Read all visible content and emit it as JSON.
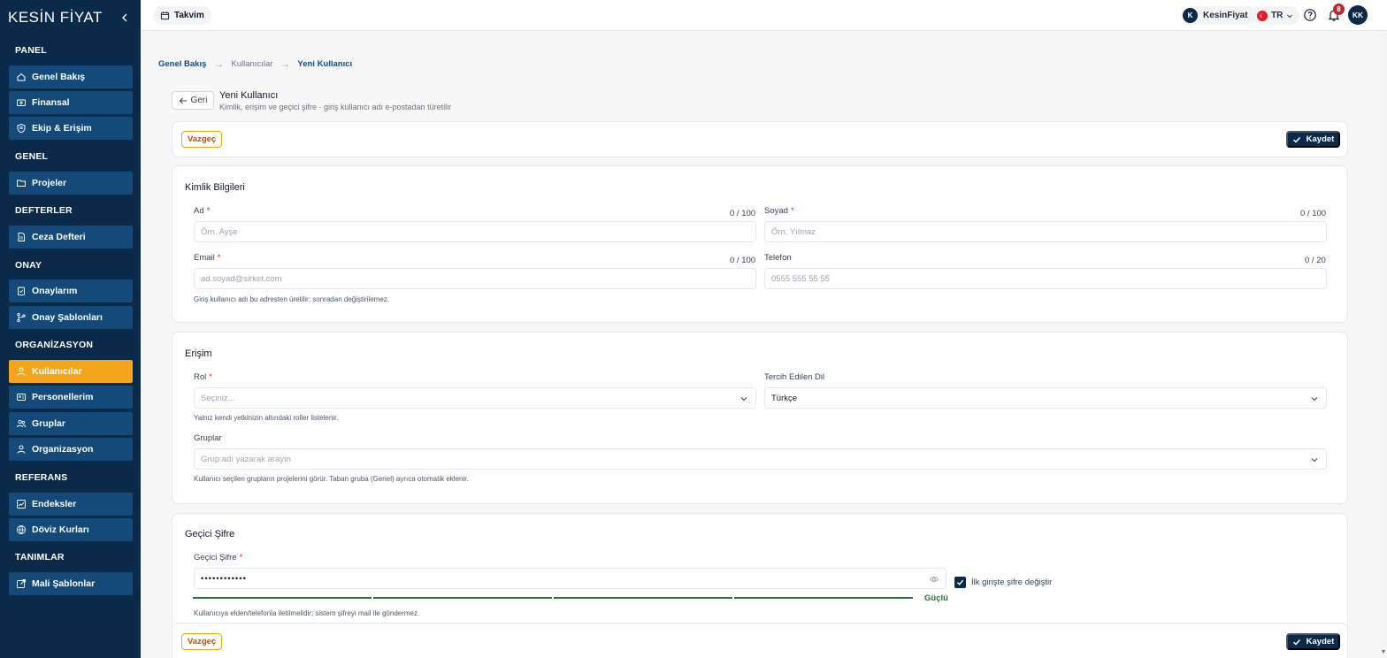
{
  "app": {
    "logo": "KESİN FİYAT"
  },
  "sidebar": {
    "sections": [
      {
        "title": "PANEL",
        "items": [
          "Genel Bakış",
          "Finansal",
          "Ekip & Erişim"
        ]
      },
      {
        "title": "GENEL",
        "items": [
          "Projeler"
        ]
      },
      {
        "title": "DEFTERLER",
        "items": [
          "Ceza Defteri"
        ]
      },
      {
        "title": "ONAY",
        "items": [
          "Onaylarım",
          "Onay Şablonları"
        ]
      },
      {
        "title": "ORGANİZASYON",
        "items": [
          "Kullanıcılar",
          "Personellerim",
          "Gruplar",
          "Organizasyon"
        ]
      },
      {
        "title": "REFERANS",
        "items": [
          "Endeksler",
          "Döviz Kurları"
        ]
      },
      {
        "title": "TANIMLAR",
        "items": [
          "Mali Şablonlar"
        ]
      }
    ],
    "active_item": "Kullanıcılar"
  },
  "topbar": {
    "calendar_label": "Takvim",
    "org_initial": "K",
    "org_name": "KesinFiyat",
    "lang_flag": "☾",
    "lang": "TR",
    "notification_count": "8",
    "user_initials": "KK"
  },
  "breadcrumb": [
    "Genel Bakış",
    "Kullanıcılar",
    "Yeni Kullanıcı"
  ],
  "page": {
    "back_label": "Geri",
    "title": "Yeni Kullanıcı",
    "subtitle": "Kimlik, erişim ve geçici şifre · giriş kullanıcı adı e-postadan türetilir"
  },
  "actions": {
    "cancel": "Vazgeç",
    "save": "Kaydet"
  },
  "identity": {
    "title": "Kimlik Bilgileri",
    "first_name": {
      "label": "Ad",
      "placeholder": "Örn. Ayşe",
      "counter": "0 / 100"
    },
    "last_name": {
      "label": "Soyad",
      "placeholder": "Örn. Yılmaz",
      "counter": "0 / 100"
    },
    "email": {
      "label": "Email",
      "placeholder": "ad.soyad@sirket.com",
      "counter": "0 / 100"
    },
    "phone": {
      "label": "Telefon",
      "placeholder": "0555 555 55 55",
      "counter": "0 / 20"
    },
    "hint": "Giriş kullanıcı adı bu adresten üretilir; sonradan değiştirilemez."
  },
  "access": {
    "title": "Erişim",
    "role": {
      "label": "Rol",
      "placeholder": "Seçiniz..."
    },
    "role_hint": "Yalnız kendi yetkinizin altındaki roller listelenir.",
    "language": {
      "label": "Tercih Edilen Dil",
      "value": "Türkçe"
    },
    "groups": {
      "label": "Gruplar",
      "placeholder": "Grup adı yazarak arayın"
    },
    "groups_hint": "Kullanıcı seçilen grupların projelerini görür. Taban gruba (Genel) ayrıca otomatik eklenir."
  },
  "temp_password": {
    "title": "Geçici Şifre",
    "label": "Geçici Şifre",
    "value": "••••••••••••",
    "strength": "Güçlü",
    "strength_level": 1.0,
    "change_on_login_label": "İlk girişte şifre değiştir",
    "change_on_login_checked": true,
    "hint": "Kullanıcıya elden/telefonla iletilmelidir; sistem şifreyi mail ile göndermez."
  },
  "colors": {
    "sidebar": "#0b2a4a",
    "nav_item": "#134a7a",
    "accent": "#f4a51c",
    "success": "#2f6b3c"
  }
}
